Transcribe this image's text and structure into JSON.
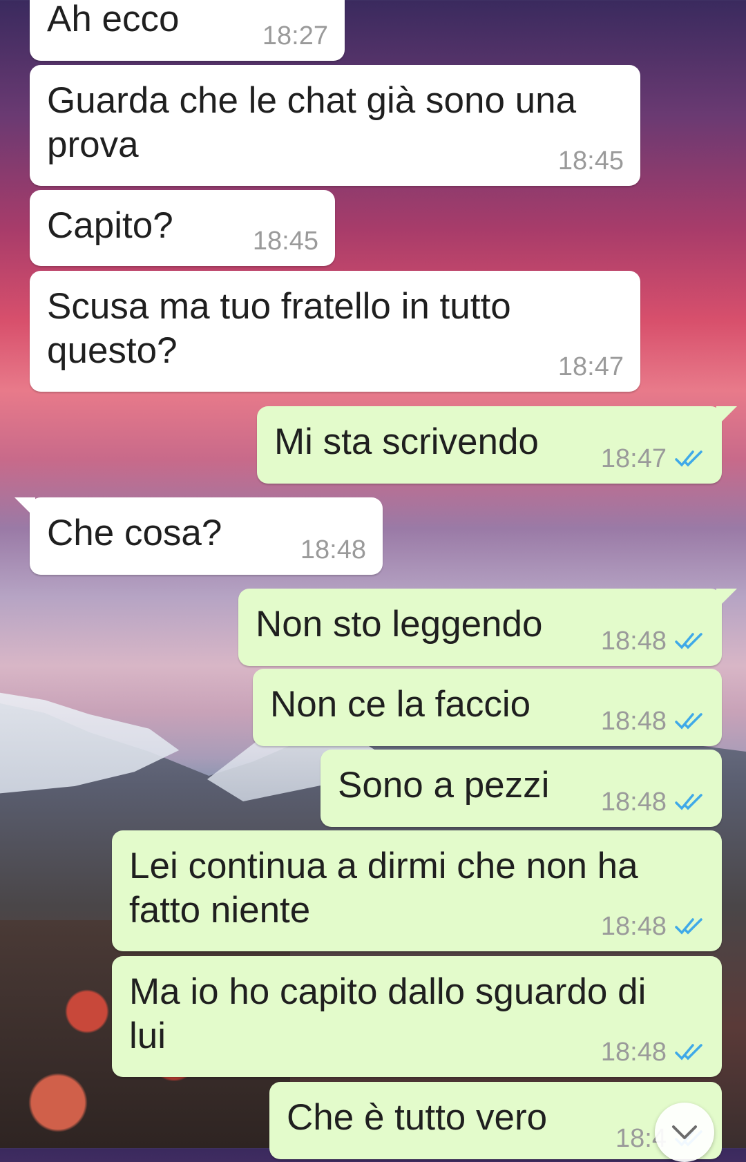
{
  "messages": [
    {
      "text": "Ah ecco",
      "time": "18:27",
      "dir": "in"
    },
    {
      "text": "Guarda che le chat già sono una\nprova",
      "time": "18:45",
      "dir": "in"
    },
    {
      "text": "Capito?",
      "time": "18:45",
      "dir": "in"
    },
    {
      "text": "Scusa ma tuo fratello in tutto\nquesto?",
      "time": "18:47",
      "dir": "in"
    },
    {
      "text": "Mi sta scrivendo",
      "time": "18:47",
      "dir": "out",
      "status": "read"
    },
    {
      "text": "Che cosa?",
      "time": "18:48",
      "dir": "in"
    },
    {
      "text": "Non sto leggendo",
      "time": "18:48",
      "dir": "out",
      "status": "read"
    },
    {
      "text": "Non ce la faccio",
      "time": "18:48",
      "dir": "out",
      "status": "read"
    },
    {
      "text": "Sono a pezzi",
      "time": "18:48",
      "dir": "out",
      "status": "read"
    },
    {
      "text": "Lei continua a dirmi che non ha\nfatto niente",
      "time": "18:48",
      "dir": "out",
      "status": "read"
    },
    {
      "text": "Ma io ho capito dallo sguardo di\nlui",
      "time": "18:48",
      "dir": "out",
      "status": "read"
    },
    {
      "text": "Che è tutto vero",
      "time": "18:4",
      "dir": "out",
      "status": "read"
    }
  ],
  "colors": {
    "incoming_bubble": "#ffffff",
    "outgoing_bubble": "#e3fbcb",
    "read_tick": "#3fa9e8",
    "timestamp": "#9a9a9a"
  },
  "icons": {
    "read_receipt": "double-check-icon",
    "scroll_down": "chevron-down-icon"
  }
}
